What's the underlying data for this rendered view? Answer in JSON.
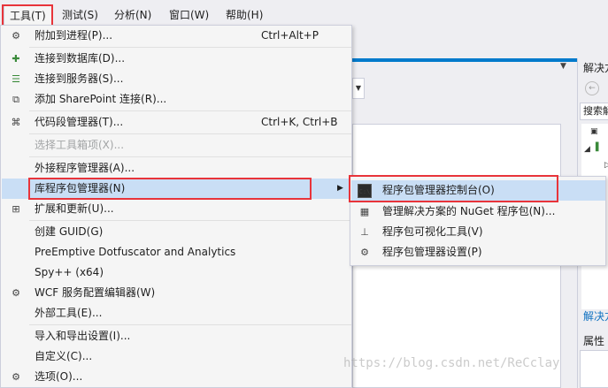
{
  "menubar": [
    {
      "label": "工具(T)"
    },
    {
      "label": "测试(S)"
    },
    {
      "label": "分析(N)"
    },
    {
      "label": "窗口(W)"
    },
    {
      "label": "帮助(H)"
    }
  ],
  "tools_menu": {
    "items": [
      {
        "label": "附加到进程(P)...",
        "shortcut": "Ctrl+Alt+P",
        "icon": "attach-process-icon"
      },
      {
        "label": "连接到数据库(D)...",
        "icon": "connect-database-icon"
      },
      {
        "label": "连接到服务器(S)...",
        "icon": "connect-server-icon"
      },
      {
        "label": "添加 SharePoint 连接(R)...",
        "icon": "sharepoint-icon"
      },
      {
        "label": "代码段管理器(T)...",
        "shortcut": "Ctrl+K, Ctrl+B",
        "icon": "snippet-icon"
      },
      {
        "label": "选择工具箱项(X)...",
        "disabled": true
      },
      {
        "label": "外接程序管理器(A)..."
      },
      {
        "label": "库程序包管理器(N)",
        "has_submenu": true,
        "highlighted": true
      },
      {
        "label": "扩展和更新(U)...",
        "icon": "extensions-icon"
      },
      {
        "label": "创建 GUID(G)"
      },
      {
        "label": "PreEmptive Dotfuscator and Analytics"
      },
      {
        "label": "Spy++ (x64)"
      },
      {
        "label": "WCF 服务配置编辑器(W)",
        "icon": "wcf-gear-icon"
      },
      {
        "label": "外部工具(E)..."
      },
      {
        "label": "导入和导出设置(I)..."
      },
      {
        "label": "自定义(C)..."
      },
      {
        "label": "选项(O)...",
        "icon": "options-gear-icon"
      }
    ]
  },
  "submenu": {
    "items": [
      {
        "label": "程序包管理器控制台(O)",
        "icon": "console-icon",
        "icon_text": "C:\\",
        "highlighted": true
      },
      {
        "label": "管理解决方案的 NuGet 程序包(N)...",
        "icon": "nuget-icon"
      },
      {
        "label": "程序包可视化工具(V)",
        "icon": "visualizer-icon"
      },
      {
        "label": "程序包管理器设置(P)",
        "icon": "settings-gear-icon"
      }
    ]
  },
  "background": {
    "solution_explorer_title": "解决方",
    "search_placeholder": "搜索解",
    "solution_link": "解决方",
    "properties_title": "属性"
  },
  "watermark": "https://blog.csdn.net/ReCclay",
  "colors": {
    "highlight": "#c9def5",
    "annotation_red": "#e8343a",
    "accent": "#007acc"
  }
}
